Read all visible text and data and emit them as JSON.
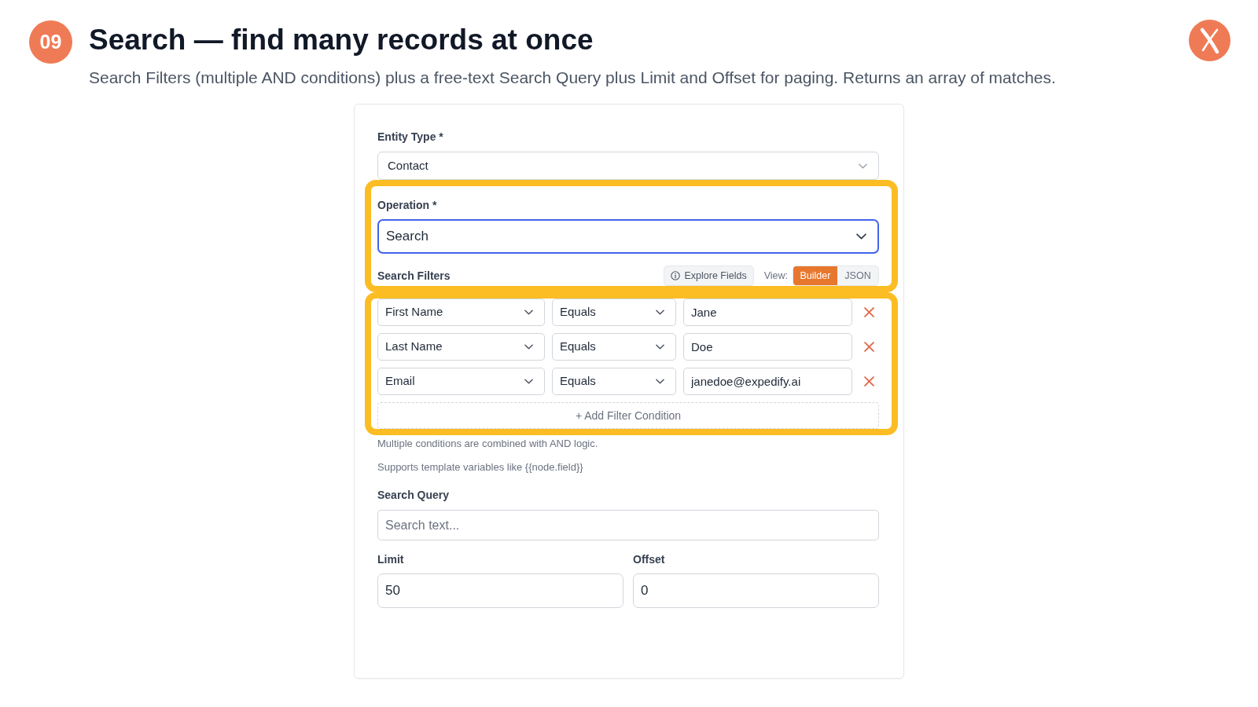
{
  "header": {
    "number": "09",
    "title": "Search — find many records at once",
    "subtitle": "Search Filters (multiple AND conditions) plus a free-text Search Query plus Limit and Offset for paging. Returns an array of matches."
  },
  "form": {
    "entity_type": {
      "label": "Entity Type *",
      "value": "Contact"
    },
    "operation": {
      "label": "Operation *",
      "value": "Search",
      "focused": true,
      "highlighted": true
    },
    "search_filters": {
      "label": "Search Filters",
      "explore_button": "Explore Fields",
      "view_label": "View:",
      "view_options": [
        {
          "label": "Builder",
          "selected": true
        },
        {
          "label": "JSON",
          "selected": false
        }
      ],
      "highlighted": true,
      "conditions": [
        {
          "field": "First Name",
          "operator": "Equals",
          "value": "Jane"
        },
        {
          "field": "Last Name",
          "operator": "Equals",
          "value": "Doe"
        },
        {
          "field": "Email",
          "operator": "Equals",
          "value": "janedoe@expedify.ai"
        }
      ],
      "add_button": "+ Add Filter Condition",
      "hints": [
        "Multiple conditions are combined with AND logic.",
        "Supports template variables like {{node.field}}"
      ]
    },
    "search_query": {
      "label": "Search Query",
      "placeholder": "Search text..."
    },
    "limit": {
      "label": "Limit",
      "value": "50"
    },
    "offset": {
      "label": "Offset",
      "value": "0"
    }
  }
}
